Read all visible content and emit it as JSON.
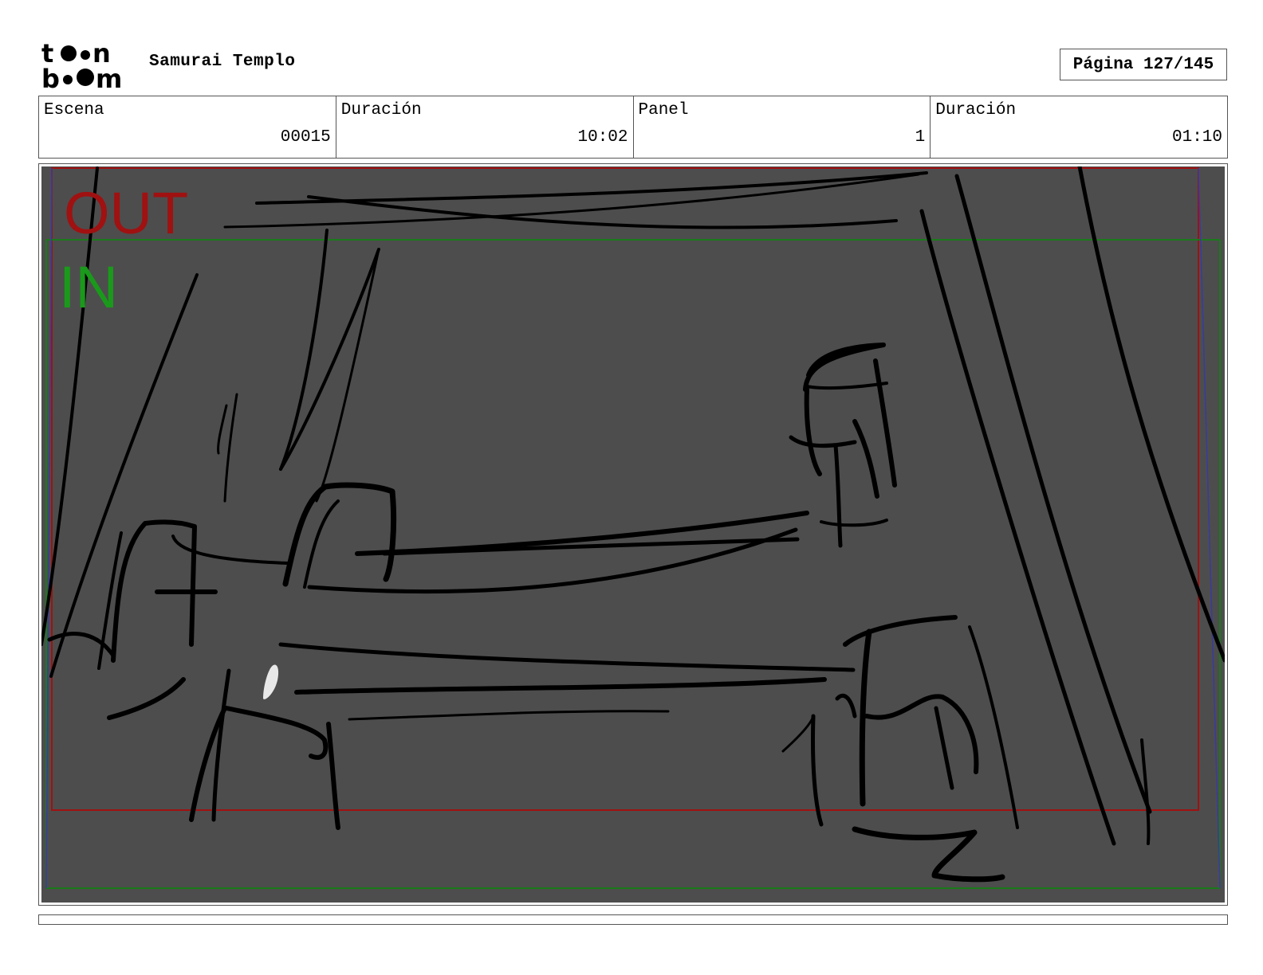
{
  "header": {
    "logo_text_top": "toon",
    "logo_text_bottom": "boom",
    "project_title": "Samurai Templo",
    "page_label": "Página 127/145"
  },
  "info": {
    "scene_label": "Escena",
    "scene_value": "00015",
    "scene_duration_label": "Duración",
    "scene_duration_value": "10:02",
    "panel_label": "Panel",
    "panel_value": "1",
    "panel_duration_label": "Duración",
    "panel_duration_value": "01:10"
  },
  "panel": {
    "out_label": "OUT",
    "in_label": "IN",
    "out_color": "#a01111",
    "in_color": "#1a9a1a",
    "background_color": "#4d4d4d"
  }
}
